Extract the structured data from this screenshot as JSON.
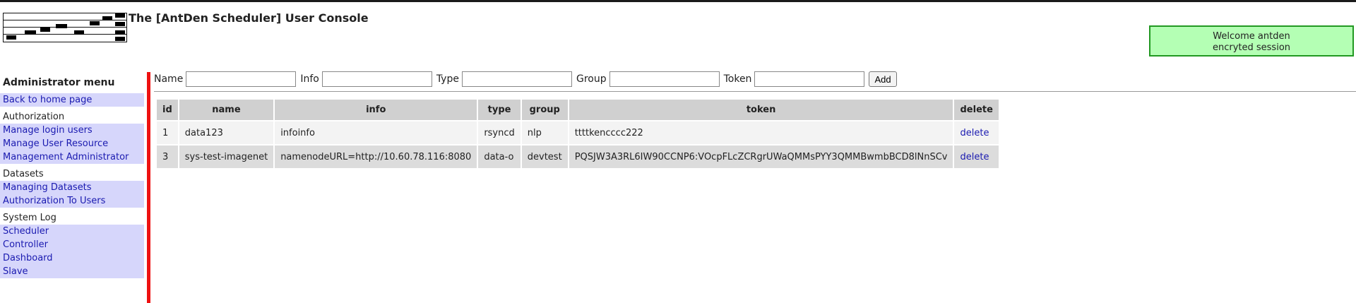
{
  "header": {
    "title": "The [AntDen Scheduler] User Console",
    "welcome_line1": "Welcome antden",
    "welcome_line2": "encryted session"
  },
  "sidebar": {
    "menu_title": "Administrator menu",
    "home": "Back to home page",
    "sections": [
      {
        "title": "Authorization",
        "items": [
          "Manage login users",
          "Manage User Resource",
          "Management Administrator"
        ]
      },
      {
        "title": "Datasets",
        "items": [
          "Managing Datasets",
          "Authorization To Users"
        ]
      },
      {
        "title": "System Log",
        "items": [
          "Scheduler",
          "Controller",
          "Dashboard",
          "Slave"
        ]
      }
    ]
  },
  "form": {
    "name_label": "Name",
    "info_label": "Info",
    "type_label": "Type",
    "group_label": "Group",
    "token_label": "Token",
    "add_label": "Add"
  },
  "table": {
    "columns": [
      "id",
      "name",
      "info",
      "type",
      "group",
      "token",
      "delete"
    ],
    "rows": [
      {
        "id": "1",
        "name": "data123",
        "info": "infoinfo",
        "type": "rsyncd",
        "group": "nlp",
        "token": "ttttkencccc222",
        "delete": "delete"
      },
      {
        "id": "3",
        "name": "sys-test-imagenet",
        "info": "namenodeURL=http://10.60.78.116:8080",
        "type": "data-o",
        "group": "devtest",
        "token": "PQSJW3A3RL6IW90CCNP6:VOcpFLcZCRgrUWaQMMsPYY3QMMBwmbBCD8lNnSCv",
        "delete": "delete"
      }
    ]
  }
}
